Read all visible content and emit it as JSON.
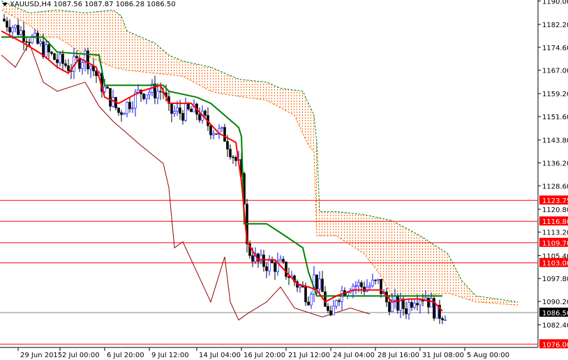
{
  "header": {
    "symbol_label": "XAUUSD,H4",
    "ohlc": "1087.56 1087.87 1086.28 1086.50"
  },
  "chart_data": {
    "type": "candlestick",
    "title": "XAUUSD,H4",
    "ylim": [
      1074.6,
      1190.0
    ],
    "y_ticks": [
      "1190.00",
      "1182.20",
      "1174.60",
      "1167.00",
      "1159.20",
      "1151.60",
      "1143.80",
      "1136.20",
      "1128.60",
      "1120.80",
      "1113.20",
      "1105.40",
      "1097.80",
      "1090.20",
      "1082.40"
    ],
    "x_ticks": [
      {
        "bar": 6,
        "label": "29 Jun 2015"
      },
      {
        "bar": 21,
        "label": "2 Jul 00:00"
      },
      {
        "bar": 37,
        "label": "6 Jul 20:00"
      },
      {
        "bar": 53,
        "label": "9 Jul 12:00"
      },
      {
        "bar": 70,
        "label": "14 Jul 04:00"
      },
      {
        "bar": 86,
        "label": "16 Jul 20:00"
      },
      {
        "bar": 102,
        "label": "21 Jul 12:00"
      },
      {
        "bar": 118,
        "label": "24 Jul 04:00"
      },
      {
        "bar": 134,
        "label": "28 Jul 16:00"
      },
      {
        "bar": 150,
        "label": "31 Jul 08:00"
      },
      {
        "bar": 166,
        "label": "5 Aug 00:00"
      }
    ],
    "levels": [
      {
        "price": 1123.75,
        "label": "1123.75",
        "color": "#ff0000"
      },
      {
        "price": 1116.8,
        "label": "1116.80",
        "color": "#ff0000"
      },
      {
        "price": 1109.7,
        "label": "1109.70",
        "color": "#ff0000"
      },
      {
        "price": 1103.0,
        "label": "1103.00",
        "color": "#ff0000"
      },
      {
        "price": 1076.0,
        "label": "1076.00",
        "color": "#ff0000"
      },
      {
        "price": 1086.5,
        "label": "1086.50",
        "color": "#000000",
        "line": "#888888"
      }
    ],
    "close": [
      [
        0,
        1184
      ],
      [
        10,
        1178
      ],
      [
        20,
        1170
      ],
      [
        25,
        1168
      ],
      [
        30,
        1172
      ],
      [
        36,
        1162
      ],
      [
        42,
        1153
      ],
      [
        50,
        1160
      ],
      [
        58,
        1160
      ],
      [
        60,
        1153
      ],
      [
        70,
        1153
      ],
      [
        75,
        1148
      ],
      [
        80,
        1145
      ],
      [
        85,
        1135
      ],
      [
        87,
        1125
      ],
      [
        88,
        1108
      ],
      [
        92,
        1103
      ],
      [
        100,
        1102
      ],
      [
        105,
        1097
      ],
      [
        110,
        1092
      ],
      [
        112,
        1098
      ],
      [
        115,
        1093
      ],
      [
        118,
        1083
      ],
      [
        120,
        1092
      ],
      [
        125,
        1096
      ],
      [
        130,
        1095
      ],
      [
        135,
        1096
      ],
      [
        138,
        1090
      ],
      [
        145,
        1088
      ],
      [
        148,
        1092
      ],
      [
        152,
        1092
      ],
      [
        156,
        1086
      ],
      [
        159,
        1086.5
      ]
    ],
    "tenkan": [
      [
        0,
        1180
      ],
      [
        8,
        1176
      ],
      [
        15,
        1172
      ],
      [
        20,
        1168
      ],
      [
        24,
        1166
      ],
      [
        28,
        1171
      ],
      [
        34,
        1168
      ],
      [
        37,
        1158
      ],
      [
        42,
        1156
      ],
      [
        50,
        1160
      ],
      [
        57,
        1162
      ],
      [
        60,
        1156
      ],
      [
        68,
        1156
      ],
      [
        72,
        1152
      ],
      [
        78,
        1146
      ],
      [
        84,
        1143
      ],
      [
        86,
        1130
      ],
      [
        88,
        1110
      ],
      [
        92,
        1104
      ],
      [
        98,
        1104
      ],
      [
        102,
        1100
      ],
      [
        106,
        1096
      ],
      [
        110,
        1095
      ],
      [
        113,
        1094
      ],
      [
        116,
        1090
      ],
      [
        120,
        1092
      ],
      [
        126,
        1094
      ],
      [
        132,
        1094
      ],
      [
        136,
        1094
      ],
      [
        140,
        1090
      ],
      [
        146,
        1091
      ],
      [
        150,
        1091
      ],
      [
        155,
        1090
      ],
      [
        158,
        1087
      ]
    ],
    "kijun": [
      [
        0,
        1178
      ],
      [
        15,
        1178
      ],
      [
        20,
        1173
      ],
      [
        35,
        1172
      ],
      [
        37,
        1162
      ],
      [
        58,
        1162
      ],
      [
        60,
        1160
      ],
      [
        70,
        1158
      ],
      [
        75,
        1156
      ],
      [
        85,
        1148
      ],
      [
        86,
        1145
      ],
      [
        87,
        1116
      ],
      [
        95,
        1116
      ],
      [
        100,
        1113
      ],
      [
        108,
        1108
      ],
      [
        110,
        1100
      ],
      [
        113,
        1092
      ],
      [
        120,
        1092
      ],
      [
        158,
        1092
      ]
    ],
    "chikou": [
      [
        0,
        1172
      ],
      [
        5,
        1168
      ],
      [
        10,
        1176
      ],
      [
        15,
        1163
      ],
      [
        20,
        1160
      ],
      [
        30,
        1163
      ],
      [
        35,
        1155
      ],
      [
        40,
        1150
      ],
      [
        50,
        1142
      ],
      [
        58,
        1136
      ],
      [
        60,
        1128
      ],
      [
        62,
        1108
      ],
      [
        65,
        1110
      ],
      [
        70,
        1100
      ],
      [
        75,
        1090
      ],
      [
        80,
        1105
      ],
      [
        82,
        1090
      ],
      [
        85,
        1084
      ],
      [
        88,
        1086
      ],
      [
        95,
        1090
      ],
      [
        100,
        1095
      ],
      [
        105,
        1088
      ],
      [
        115,
        1085
      ],
      [
        125,
        1088
      ],
      [
        132,
        1086
      ]
    ],
    "span_b": [
      [
        0,
        1190
      ],
      [
        10,
        1186
      ],
      [
        20,
        1187
      ],
      [
        30,
        1186
      ],
      [
        40,
        1187
      ],
      [
        43,
        1185
      ],
      [
        45,
        1180
      ],
      [
        55,
        1176
      ],
      [
        60,
        1172
      ],
      [
        65,
        1170
      ],
      [
        75,
        1168
      ],
      [
        80,
        1166
      ],
      [
        85,
        1164
      ],
      [
        95,
        1163
      ],
      [
        100,
        1161
      ],
      [
        108,
        1160
      ],
      [
        112,
        1152
      ],
      [
        113,
        1143
      ],
      [
        114,
        1120
      ],
      [
        120,
        1120
      ],
      [
        130,
        1119
      ],
      [
        140,
        1117
      ],
      [
        150,
        1112
      ],
      [
        160,
        1106
      ],
      [
        165,
        1097
      ],
      [
        170,
        1092
      ],
      [
        185,
        1090
      ]
    ],
    "span_a": [
      [
        0,
        1187
      ],
      [
        10,
        1182
      ],
      [
        15,
        1178
      ],
      [
        20,
        1178
      ],
      [
        30,
        1172
      ],
      [
        40,
        1168
      ],
      [
        45,
        1167
      ],
      [
        55,
        1166
      ],
      [
        65,
        1165
      ],
      [
        75,
        1160
      ],
      [
        80,
        1159
      ],
      [
        95,
        1157
      ],
      [
        105,
        1152
      ],
      [
        110,
        1142
      ],
      [
        112,
        1140
      ],
      [
        113,
        1112
      ],
      [
        120,
        1112
      ],
      [
        125,
        1109
      ],
      [
        130,
        1106
      ],
      [
        135,
        1100
      ],
      [
        140,
        1092
      ],
      [
        150,
        1092
      ],
      [
        160,
        1093
      ],
      [
        170,
        1090
      ],
      [
        185,
        1089
      ]
    ],
    "colors": {
      "tenkan": "#ff0000",
      "kijun": "#008000",
      "chikou": "#990000",
      "cloud": "#ff6600",
      "bull": "#0000ff",
      "bear": "#ff0000"
    }
  }
}
